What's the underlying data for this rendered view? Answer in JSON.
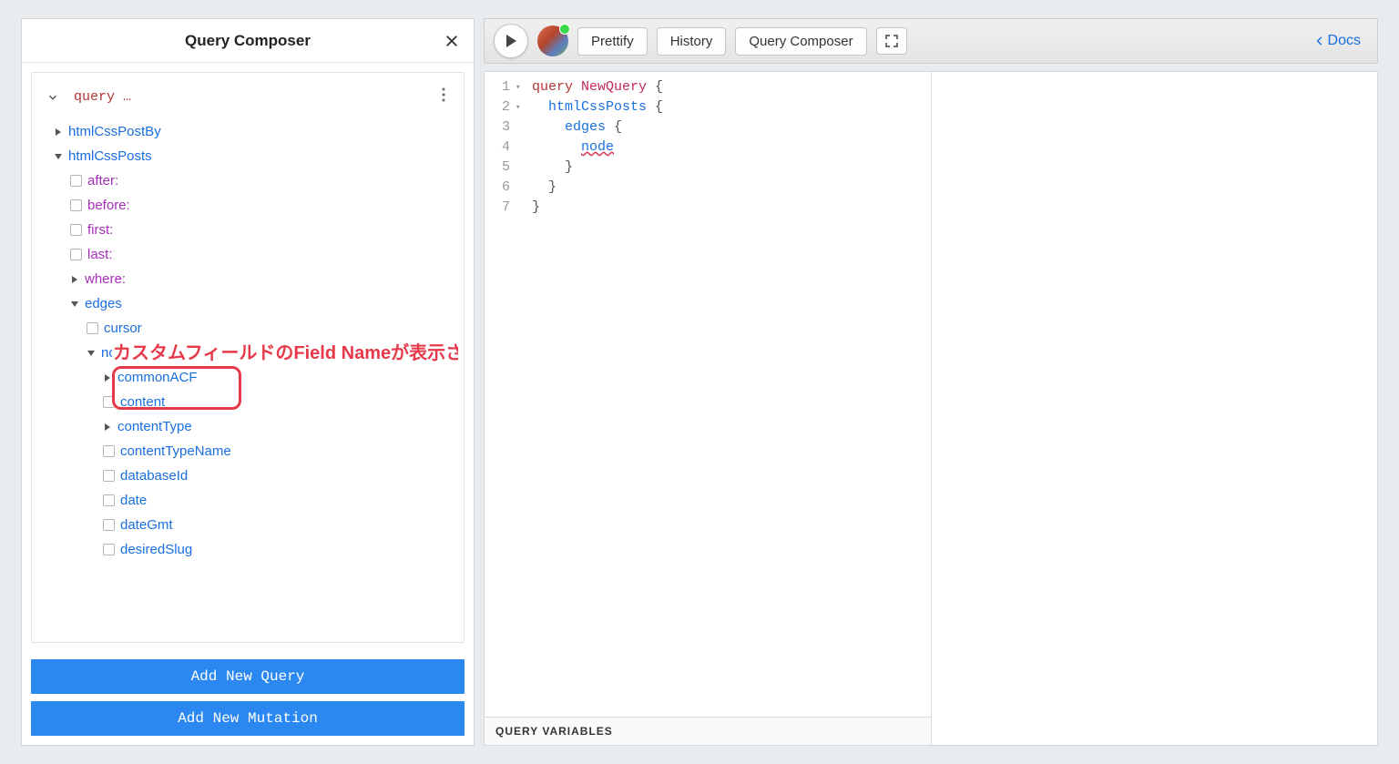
{
  "composer": {
    "title": "Query Composer",
    "query_label": "query …",
    "tree": {
      "htmlCssPostBy": "htmlCssPostBy",
      "htmlCssPosts": "htmlCssPosts",
      "after": "after:",
      "before": "before:",
      "first": "first:",
      "last": "last:",
      "where": "where:",
      "edges": "edges",
      "cursor": "cursor",
      "node": "node",
      "commonACF": "commonACF",
      "content": "content",
      "contentType": "contentType",
      "contentTypeName": "contentTypeName",
      "databaseId": "databaseId",
      "date": "date",
      "dateGmt": "dateGmt",
      "desiredSlug": "desiredSlug"
    },
    "annotation": "カスタムフィールドのField Nameが表示されることを確認",
    "footer": {
      "add_query": "Add New Query",
      "add_mutation": "Add New Mutation"
    }
  },
  "toolbar": {
    "prettify": "Prettify",
    "history": "History",
    "qcomposer": "Query Composer",
    "docs": "Docs"
  },
  "editor": {
    "lines": [
      "1",
      "2",
      "3",
      "4",
      "5",
      "6",
      "7"
    ],
    "fold": [
      "▾",
      "▾",
      "",
      "",
      "",
      "",
      ""
    ],
    "code": {
      "l1_kw": "query",
      "l1_name": "NewQuery",
      "l1_brace": " {",
      "l2": "htmlCssPosts",
      "l3": "edges",
      "l4": "node",
      "brace_open": " {",
      "brace_close": "}"
    }
  },
  "vars_label": "QUERY VARIABLES"
}
